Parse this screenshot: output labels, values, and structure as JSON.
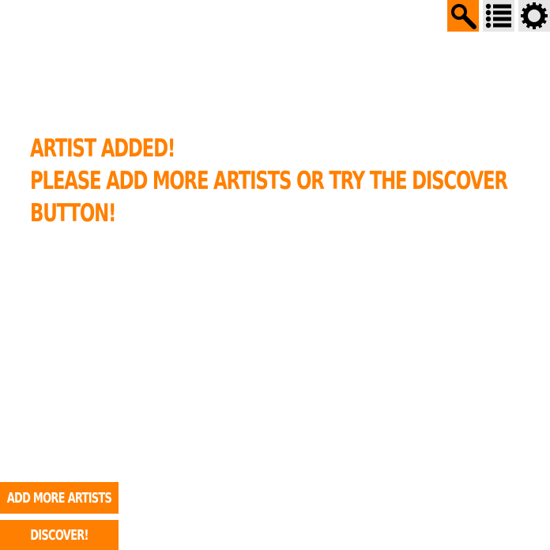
{
  "toolbar": {
    "search_icon": "search-icon",
    "list_icon": "list-icon",
    "settings_icon": "gear-icon"
  },
  "message": {
    "line1": "Artist added!",
    "line2": "Please add more artists or try the Discover",
    "line3": "button!"
  },
  "buttons": {
    "add_more_artists": "Add more artists",
    "discover": "Discover!"
  },
  "colors": {
    "accent": "#ff7f00",
    "toolbar_bg": "#e6e6e6",
    "text_on_accent": "#ffffff"
  }
}
